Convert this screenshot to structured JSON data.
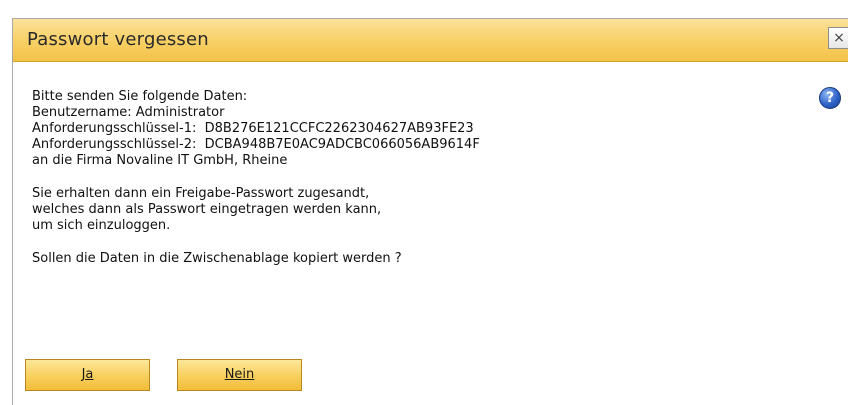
{
  "dialog": {
    "title": "Passwort vergessen",
    "close_label": "×",
    "help_label": "?",
    "lines": [
      "Bitte senden Sie folgende Daten:",
      "Benutzername: Administrator",
      "Anforderungsschlüssel-1:  D8B276E121CCFC2262304627AB93FE23",
      "Anforderungsschlüssel-2:  DCBA948B7E0AC9ADCBC066056AB9614F",
      "an die Firma Novaline IT GmbH, Rheine",
      "Sie erhalten dann ein Freigabe-Passwort zugesandt,",
      "welches dann als Passwort eingetragen werden kann,",
      "um sich einzuloggen.",
      "Sollen die Daten in die Zwischenablage kopiert werden ?"
    ],
    "buttons": {
      "yes": "Ja",
      "no": "Nein"
    }
  }
}
